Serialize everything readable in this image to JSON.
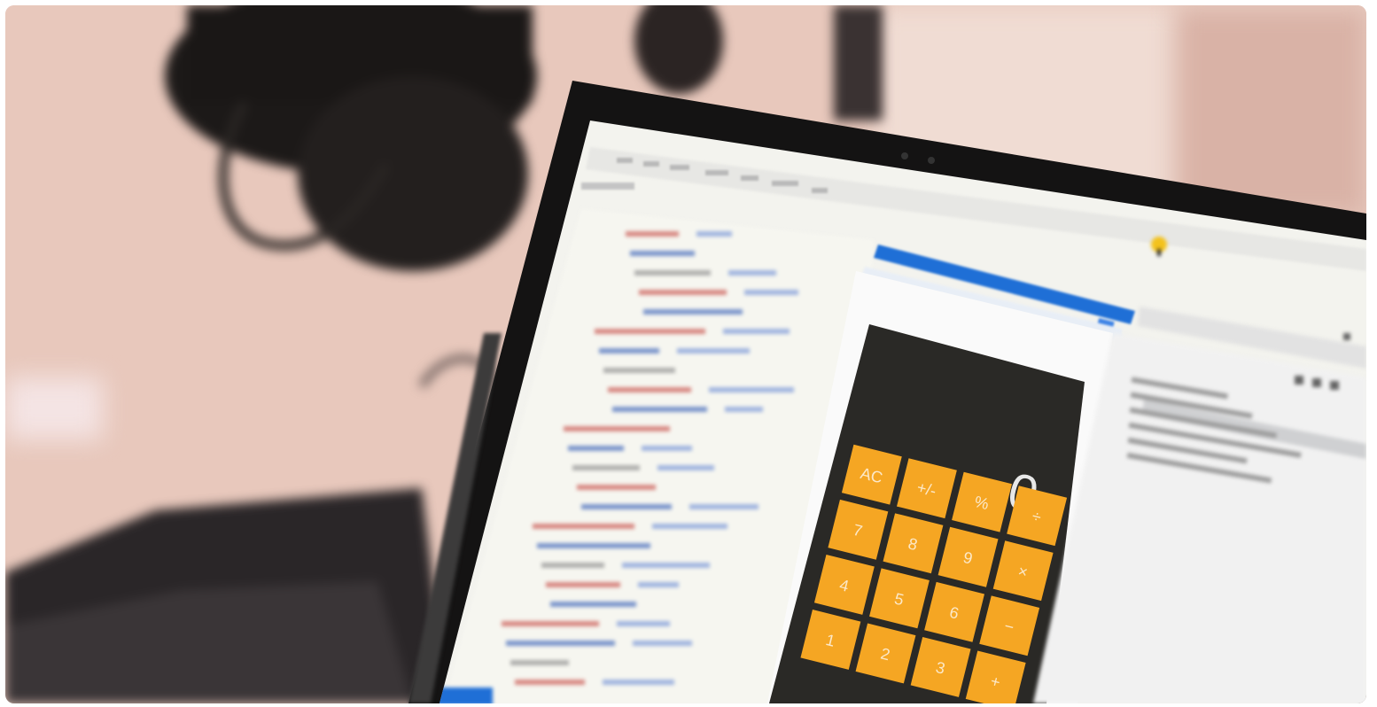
{
  "photo": {
    "description_colors": {
      "wall": "#e6c7bb",
      "shadow": "#1d1a1a",
      "bezel": "#151515",
      "editor_bg": "#f4f4ef",
      "calc_body": "#2b2a27",
      "calc_key": "#f5a623",
      "panel_bg": "#f7f7f7",
      "accent_blue": "#1f6fd6"
    }
  },
  "calculator": {
    "display_value": "0",
    "top_row_keys": [
      "AC",
      "+/-",
      "%",
      "÷"
    ],
    "digit_rows": [
      [
        "7",
        "8",
        "9",
        "×"
      ],
      [
        "4",
        "5",
        "6",
        "−"
      ],
      [
        "1",
        "2",
        "3",
        "+"
      ]
    ]
  }
}
